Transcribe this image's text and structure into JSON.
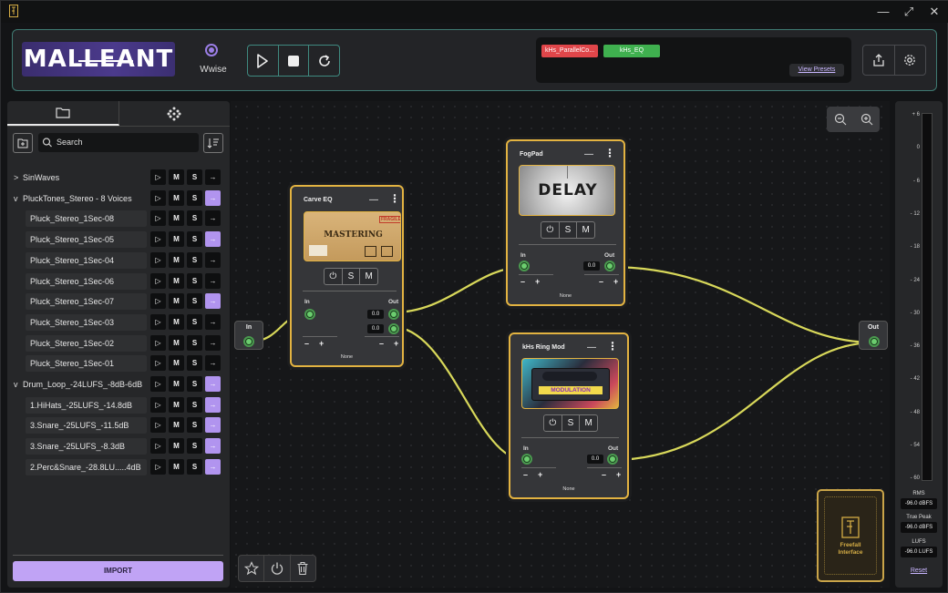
{
  "window": {
    "icon": "app-icon",
    "controls": [
      "minimize",
      "maximize",
      "close"
    ]
  },
  "header": {
    "logo": "MALLEANT",
    "engine_label": "Wwise",
    "transport": {
      "play": "play-icon",
      "stop": "stop-icon",
      "loop": "repeat-icon"
    },
    "presets": {
      "chips": [
        {
          "label": "kHs_ParallelCo...",
          "color": "#e0464a"
        },
        {
          "label": "kHs_EQ",
          "color": "#3fb04f"
        }
      ],
      "view_label": "View Presets"
    },
    "actions": [
      "share-icon",
      "gear-icon"
    ]
  },
  "browser": {
    "search_placeholder": "Search",
    "import_label": "IMPORT",
    "items": [
      {
        "name": "SinWaves",
        "level": 0,
        "expand": ">",
        "arrow_active": false
      },
      {
        "name": "PluckTones_Stereo - 8 Voices",
        "level": 0,
        "expand": "v",
        "arrow_active": true
      },
      {
        "name": "Pluck_Stereo_1Sec-08",
        "level": 1,
        "arrow_active": false
      },
      {
        "name": "Pluck_Stereo_1Sec-05",
        "level": 1,
        "arrow_active": true
      },
      {
        "name": "Pluck_Stereo_1Sec-04",
        "level": 1,
        "arrow_active": false
      },
      {
        "name": "Pluck_Stereo_1Sec-06",
        "level": 1,
        "arrow_active": false
      },
      {
        "name": "Pluck_Stereo_1Sec-07",
        "level": 1,
        "arrow_active": true
      },
      {
        "name": "Pluck_Stereo_1Sec-03",
        "level": 1,
        "arrow_active": false
      },
      {
        "name": "Pluck_Stereo_1Sec-02",
        "level": 1,
        "arrow_active": false
      },
      {
        "name": "Pluck_Stereo_1Sec-01",
        "level": 1,
        "arrow_active": false
      },
      {
        "name": "Drum_Loop_-24LUFS_-8dB-6dB",
        "level": 0,
        "expand": "v",
        "arrow_active": true
      },
      {
        "name": "1.HiHats_-25LUFS_-14.8dB",
        "level": 1,
        "arrow_active": true
      },
      {
        "name": "3.Snare_-25LUFS_-11.5dB",
        "level": 1,
        "arrow_active": true
      },
      {
        "name": "3.Snare_-25LUFS_-8.3dB",
        "level": 1,
        "arrow_active": true
      },
      {
        "name": "2.Perc&Snare_-28.8LU.....4dB",
        "level": 1,
        "arrow_active": true
      }
    ],
    "row_buttons": {
      "play": "▷",
      "mute": "M",
      "solo": "S",
      "send": "→"
    }
  },
  "graph": {
    "in_label": "In",
    "out_label": "Out",
    "nodes": [
      {
        "id": "carve",
        "title": "Carve EQ",
        "thumb_text": "MASTERING",
        "thumb_badge": "FRAGILE",
        "in": "In",
        "out": "Out",
        "values": [
          "0.0",
          "0.0"
        ],
        "footer": "None"
      },
      {
        "id": "fogpad",
        "title": "FogPad",
        "thumb_text": "DELAY",
        "in": "In",
        "out": "Out",
        "values": [
          "0.0"
        ],
        "footer": "None"
      },
      {
        "id": "ringmod",
        "title": "kHs Ring Mod",
        "thumb_text": "MODULATION",
        "in": "In",
        "out": "Out",
        "values": [
          "0.0"
        ],
        "footer": "None"
      }
    ],
    "psm": [
      "⏻",
      "S",
      "M"
    ],
    "minus": "–",
    "plus": "+",
    "minimize": "—",
    "menu": "⋮"
  },
  "meter": {
    "ticks": [
      "+ 6",
      "0",
      "- 6",
      "- 12",
      "- 18",
      "- 24",
      "- 30",
      "- 36",
      "- 42",
      "- 48",
      "- 54",
      "- 60"
    ],
    "rms_label": "RMS",
    "rms_value": "-96.0 dBFS",
    "peak_label": "True Peak",
    "peak_value": "-96.0 dBFS",
    "lufs_label": "LUFS",
    "lufs_value": "-96.0 LUFS",
    "reset_label": "Reset"
  },
  "brand_card": {
    "line1": "Freefall",
    "line2": "Interface"
  },
  "colors": {
    "accent": "#b194ef",
    "node_border": "#e3b341",
    "wire": "#d8d85a",
    "header_border": "#3f7a72"
  }
}
